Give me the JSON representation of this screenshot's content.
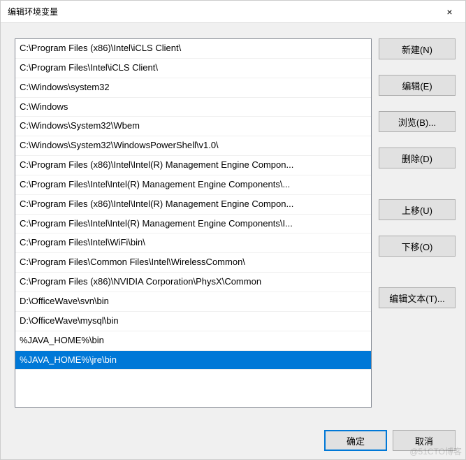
{
  "window": {
    "title": "编辑环境变量",
    "close_label": "×"
  },
  "list": {
    "items": [
      {
        "text": "C:\\Program Files (x86)\\Intel\\iCLS Client\\",
        "selected": false
      },
      {
        "text": "C:\\Program Files\\Intel\\iCLS Client\\",
        "selected": false
      },
      {
        "text": "C:\\Windows\\system32",
        "selected": false
      },
      {
        "text": "C:\\Windows",
        "selected": false
      },
      {
        "text": "C:\\Windows\\System32\\Wbem",
        "selected": false
      },
      {
        "text": "C:\\Windows\\System32\\WindowsPowerShell\\v1.0\\",
        "selected": false
      },
      {
        "text": "C:\\Program Files (x86)\\Intel\\Intel(R) Management Engine Compon...",
        "selected": false
      },
      {
        "text": "C:\\Program Files\\Intel\\Intel(R) Management Engine Components\\...",
        "selected": false
      },
      {
        "text": "C:\\Program Files (x86)\\Intel\\Intel(R) Management Engine Compon...",
        "selected": false
      },
      {
        "text": "C:\\Program Files\\Intel\\Intel(R) Management Engine Components\\I...",
        "selected": false
      },
      {
        "text": "C:\\Program Files\\Intel\\WiFi\\bin\\",
        "selected": false
      },
      {
        "text": "C:\\Program Files\\Common Files\\Intel\\WirelessCommon\\",
        "selected": false
      },
      {
        "text": "C:\\Program Files (x86)\\NVIDIA Corporation\\PhysX\\Common",
        "selected": false
      },
      {
        "text": "D:\\OfficeWave\\svn\\bin",
        "selected": false
      },
      {
        "text": "D:\\OfficeWave\\mysql\\bin",
        "selected": false
      },
      {
        "text": "%JAVA_HOME%\\bin",
        "selected": false
      },
      {
        "text": "%JAVA_HOME%\\jre\\bin",
        "selected": true
      }
    ]
  },
  "buttons": {
    "new_label": "新建(N)",
    "edit_label": "编辑(E)",
    "browse_label": "浏览(B)...",
    "delete_label": "删除(D)",
    "moveup_label": "上移(U)",
    "movedown_label": "下移(O)",
    "edittext_label": "编辑文本(T)...",
    "ok_label": "确定",
    "cancel_label": "取消"
  },
  "watermark": "@51CTO博客"
}
